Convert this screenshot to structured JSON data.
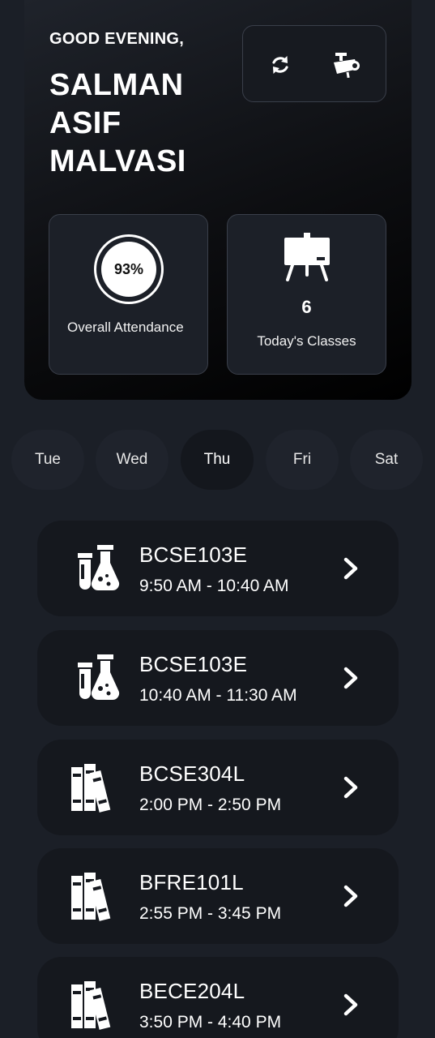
{
  "header": {
    "greeting": "GOOD EVENING,",
    "user_name": "SALMAN ASIF MALVASI",
    "actions": [
      {
        "icon": "refresh-icon"
      },
      {
        "icon": "projector-icon"
      }
    ]
  },
  "stats": {
    "attendance_percent": "93%",
    "attendance_label": "Overall Attendance",
    "classes_count": "6",
    "classes_label": "Today's Classes"
  },
  "days": [
    {
      "label": "Tue",
      "active": false
    },
    {
      "label": "Wed",
      "active": false
    },
    {
      "label": "Thu",
      "active": true
    },
    {
      "label": "Fri",
      "active": false
    },
    {
      "label": "Sat",
      "active": false
    }
  ],
  "classes": [
    {
      "code": "BCSE103E",
      "time": "9:50 AM - 10:40 AM",
      "icon": "lab-flask-icon"
    },
    {
      "code": "BCSE103E",
      "time": "10:40 AM - 11:30 AM",
      "icon": "lab-flask-icon"
    },
    {
      "code": "BCSE304L",
      "time": "2:00 PM - 2:50 PM",
      "icon": "books-icon"
    },
    {
      "code": "BFRE101L",
      "time": "2:55 PM - 3:45 PM",
      "icon": "books-icon"
    },
    {
      "code": "BECE204L",
      "time": "3:50 PM - 4:40 PM",
      "icon": "books-icon"
    }
  ],
  "colors": {
    "background": "#1b1f27",
    "card": "#15181e",
    "accent": "#ffffff"
  }
}
